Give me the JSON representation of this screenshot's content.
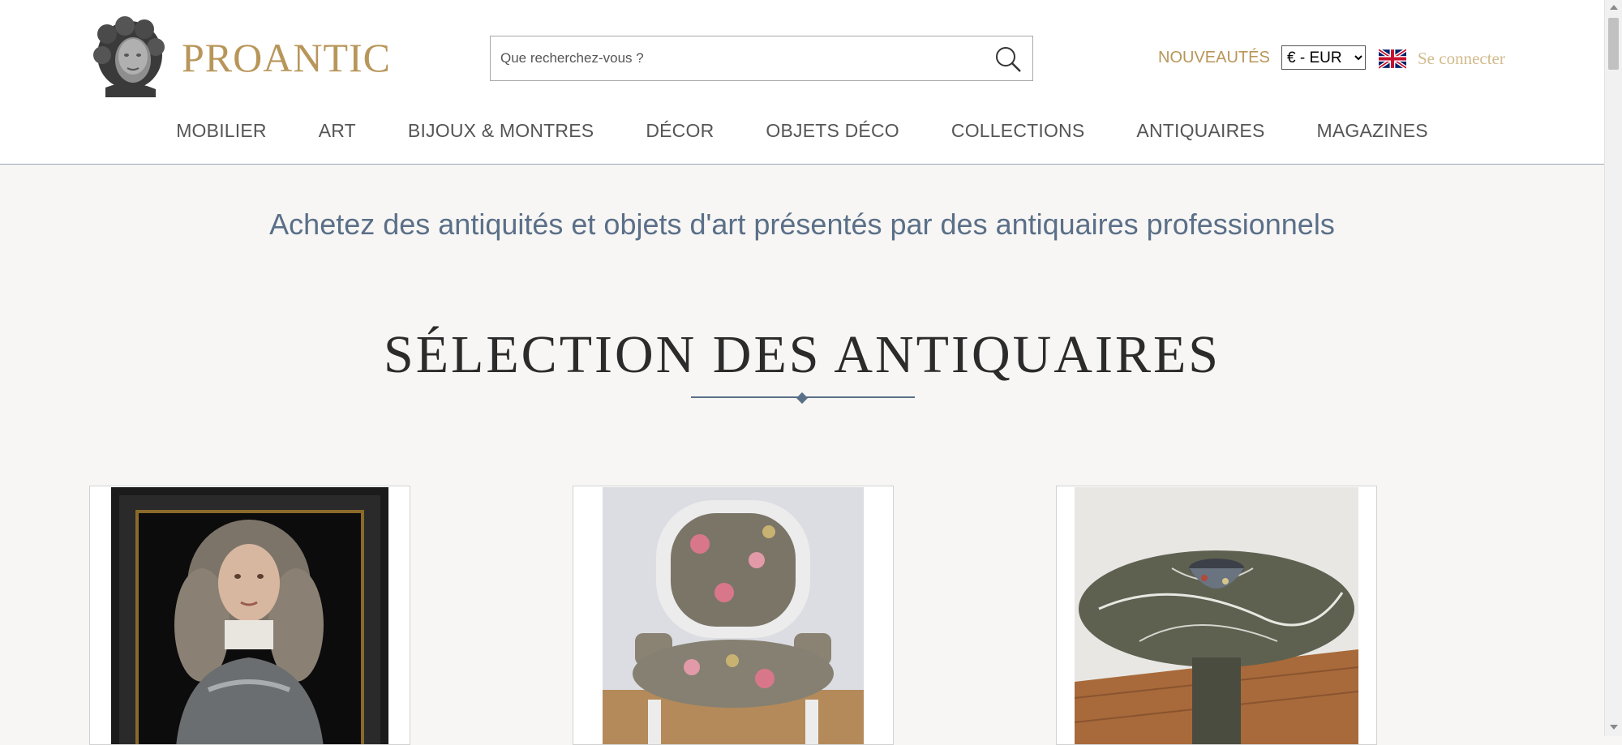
{
  "brand": {
    "name": "PROANTIC"
  },
  "search": {
    "placeholder": "Que recherchez-vous ?"
  },
  "header": {
    "nouveautes": "NOUVEAUTÉS",
    "currency_selected": "€ - EUR",
    "login": "Se connecter"
  },
  "nav": {
    "items": [
      {
        "label": "MOBILIER"
      },
      {
        "label": "ART"
      },
      {
        "label": "BIJOUX & MONTRES"
      },
      {
        "label": "DÉCOR"
      },
      {
        "label": "OBJETS DÉCO"
      },
      {
        "label": "COLLECTIONS"
      },
      {
        "label": "ANTIQUAIRES"
      },
      {
        "label": "MAGAZINES"
      }
    ]
  },
  "main": {
    "tagline": "Achetez des antiquités et objets d'art présentés par des antiquaires professionnels",
    "section_title": "SÉLECTION DES ANTIQUAIRES"
  },
  "colors": {
    "brand_gold": "#b8965a",
    "accent_blue": "#5a6f88",
    "background": "#f7f6f4"
  },
  "icons": {
    "search": "search-icon",
    "flag": "uk-flag-icon",
    "logo": "bust-logo-icon"
  }
}
